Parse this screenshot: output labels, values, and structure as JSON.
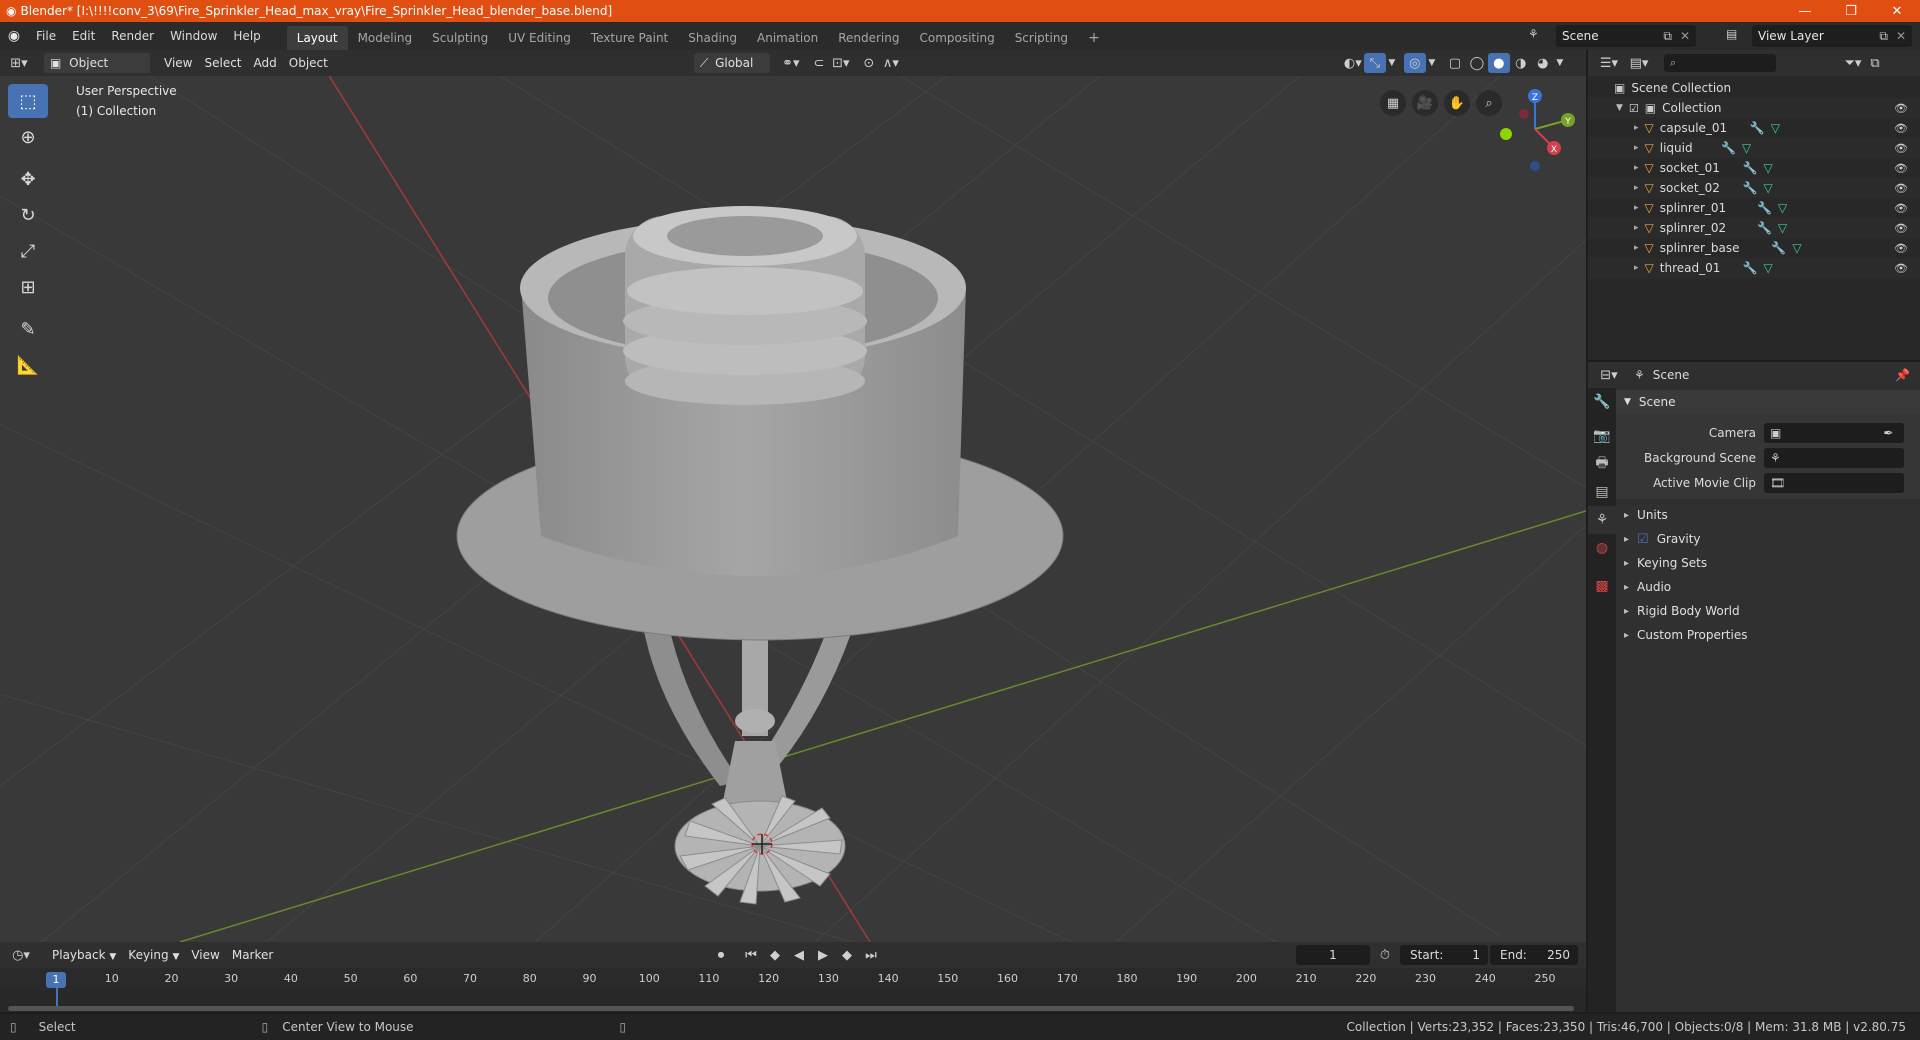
{
  "window": {
    "title": "Blender* [I:\\!!!!conv_3\\69\\Fire_Sprinkler_Head_max_vray\\Fire_Sprinkler_Head_blender_base.blend]"
  },
  "menu": [
    "File",
    "Edit",
    "Render",
    "Window",
    "Help"
  ],
  "workspaces": [
    "Layout",
    "Modeling",
    "Sculpting",
    "UV Editing",
    "Texture Paint",
    "Shading",
    "Animation",
    "Rendering",
    "Compositing",
    "Scripting"
  ],
  "active_workspace": "Layout",
  "scene_selector": "Scene",
  "view_layer": "View Layer",
  "viewport_header": {
    "mode": "Object Mode",
    "menus": [
      "View",
      "Select",
      "Add",
      "Object"
    ],
    "orientation": "Global"
  },
  "viewport_overlay": {
    "line1": "User Perspective",
    "line2": "(1) Collection"
  },
  "gizmo": {
    "z": "Z",
    "y": "Y",
    "x": "X"
  },
  "outliner": {
    "root": "Scene Collection",
    "collection": "Collection",
    "objects": [
      "capsule_01",
      "liquid",
      "socket_01",
      "socket_02",
      "splinrer_01",
      "splinrer_02",
      "splinrer_base",
      "thread_01"
    ]
  },
  "properties": {
    "context": "Scene",
    "panel": "Scene",
    "fields": [
      {
        "label": "Camera",
        "value": ""
      },
      {
        "label": "Background Scene",
        "value": ""
      },
      {
        "label": "Active Movie Clip",
        "value": ""
      }
    ],
    "subpanels": [
      "Units",
      "Gravity",
      "Keying Sets",
      "Audio",
      "Rigid Body World",
      "Custom Properties"
    ],
    "gravity_checked": true
  },
  "timeline": {
    "menus": [
      "Playback",
      "Keying",
      "View",
      "Marker"
    ],
    "current_frame": "1",
    "start_label": "Start:",
    "start": "1",
    "end_label": "End:",
    "end": "250",
    "ticks": [
      "1",
      "10",
      "20",
      "30",
      "40",
      "50",
      "60",
      "70",
      "80",
      "90",
      "100",
      "110",
      "120",
      "130",
      "140",
      "150",
      "160",
      "170",
      "180",
      "190",
      "200",
      "210",
      "220",
      "230",
      "240",
      "250"
    ]
  },
  "statusbar": {
    "left": "Select",
    "middle": "Center View to Mouse",
    "right": "Collection | Verts:23,352 | Faces:23,350 | Tris:46,700 | Objects:0/8 | Mem: 31.8 MB | v2.80.75"
  }
}
